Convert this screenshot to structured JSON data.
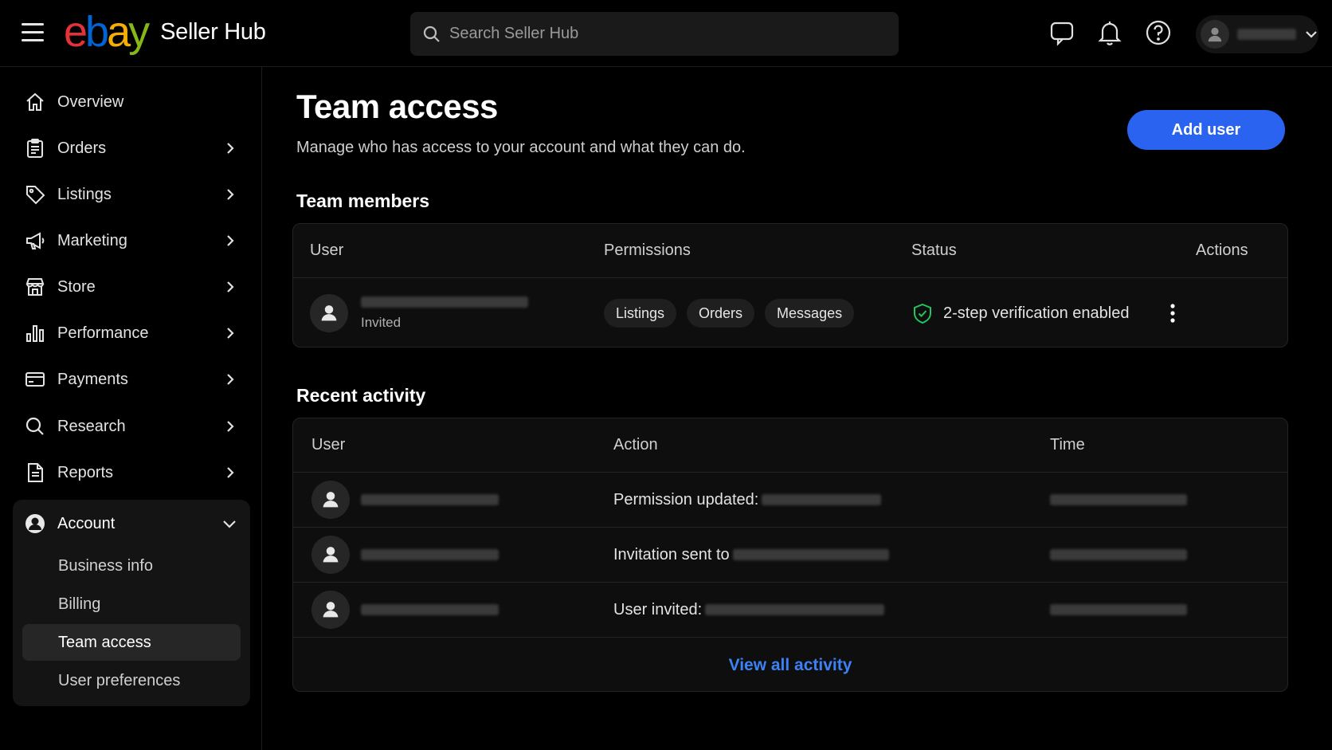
{
  "header": {
    "logo": {
      "e": "e",
      "b": "b",
      "a": "a",
      "y": "y",
      "suffix": "Seller Hub"
    },
    "search_placeholder": "Search Seller Hub",
    "icons": [
      "menu-icon",
      "message-icon",
      "bell-icon",
      "help-icon",
      "avatar-icon",
      "chevron-down-icon"
    ]
  },
  "sidebar": {
    "items": [
      {
        "label": "Overview",
        "icon": "home-icon"
      },
      {
        "label": "Orders",
        "icon": "clipboard-icon"
      },
      {
        "label": "Listings",
        "icon": "tag-icon"
      },
      {
        "label": "Marketing",
        "icon": "megaphone-icon"
      },
      {
        "label": "Store",
        "icon": "store-icon"
      },
      {
        "label": "Performance",
        "icon": "bar-chart-icon"
      },
      {
        "label": "Payments",
        "icon": "card-icon"
      },
      {
        "label": "Research",
        "icon": "search-icon"
      },
      {
        "label": "Reports",
        "icon": "document-icon"
      }
    ],
    "account": {
      "label": "Account",
      "sub_items": [
        "Business info",
        "Billing",
        "Team access",
        "User preferences"
      ],
      "active": "Team access"
    }
  },
  "main": {
    "title": "Team access",
    "subtitle": "Manage who has access to your account and what they can do.",
    "add_user_label": "Add user",
    "team_members": {
      "title": "Team members",
      "columns": [
        "User",
        "Permissions",
        "Status",
        "Actions"
      ],
      "rows": [
        {
          "user_sub": "Invited",
          "permissions": [
            "Listings",
            "Orders",
            "Messages"
          ],
          "status": "2-step verification enabled"
        }
      ]
    },
    "recent_activity": {
      "title": "Recent activity",
      "columns": [
        "User",
        "Action",
        "Time"
      ],
      "rows": [
        {
          "action": "Permission updated:"
        },
        {
          "action": "Invitation sent to"
        },
        {
          "action": "User invited:"
        }
      ],
      "view_all_label": "View all activity"
    }
  },
  "colors": {
    "accent": "#2a63f0",
    "link": "#3b82f6",
    "success": "#22c55e",
    "ebay_red": "#e53238",
    "ebay_blue": "#0064d2",
    "ebay_yellow": "#f5af02",
    "ebay_green": "#86b817"
  }
}
